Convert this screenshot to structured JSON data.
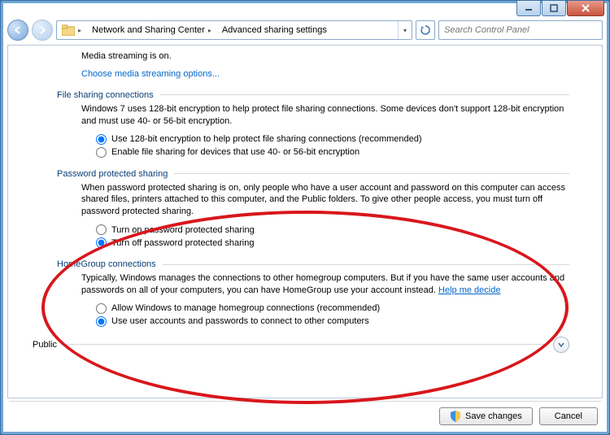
{
  "breadcrumb": {
    "segment1": "Network and Sharing Center",
    "segment2": "Advanced sharing settings"
  },
  "search": {
    "placeholder": "Search Control Panel"
  },
  "top": {
    "status": "Media streaming is on.",
    "link": "Choose media streaming options..."
  },
  "sections": {
    "file": {
      "title": "File sharing connections",
      "desc": "Windows 7 uses 128-bit encryption to help protect file sharing connections. Some devices don't support 128-bit encryption and must use 40- or 56-bit encryption.",
      "opts": {
        "a": "Use 128-bit encryption to help protect file sharing connections (recommended)",
        "b": "Enable file sharing for devices that use 40- or 56-bit encryption"
      }
    },
    "pwd": {
      "title": "Password protected sharing",
      "desc": "When password protected sharing is on, only people who have a user account and password on this computer can access shared files, printers attached to this computer, and the Public folders. To give other people access, you must turn off password protected sharing.",
      "opts": {
        "a": "Turn on password protected sharing",
        "b": "Turn off password protected sharing"
      }
    },
    "hg": {
      "title": "HomeGroup connections",
      "desc_pre": "Typically, Windows manages the connections to other homegroup computers. But if you have the same user accounts and passwords on all of your computers, you can have HomeGroup use your account instead. ",
      "link": "Help me decide",
      "opts": {
        "a": "Allow Windows to manage homegroup connections (recommended)",
        "b": "Use user accounts and passwords to connect to other computers"
      }
    }
  },
  "public": {
    "label": "Public"
  },
  "footer": {
    "save": "Save changes",
    "cancel": "Cancel"
  },
  "annotation_color": "#d8171c"
}
